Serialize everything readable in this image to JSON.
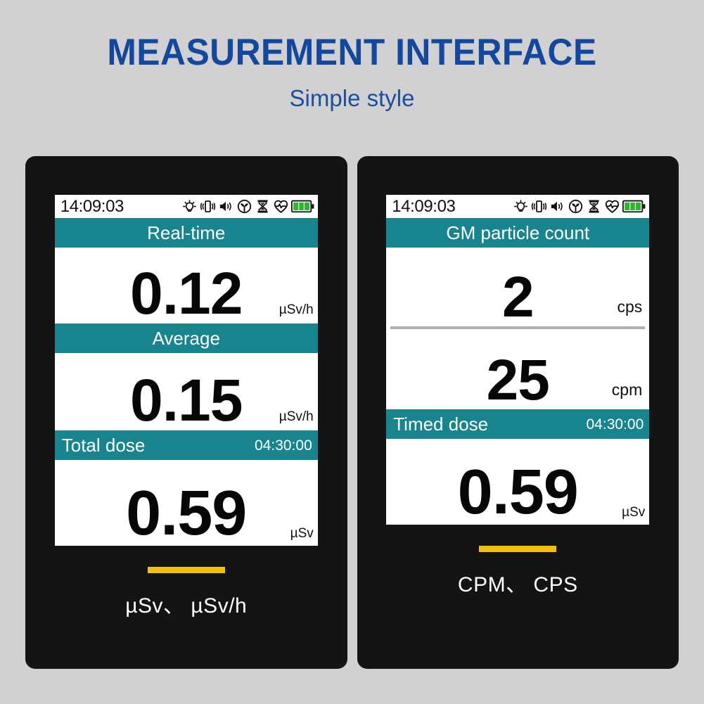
{
  "header": {
    "title": "MEASUREMENT INTERFACE",
    "subtitle": "Simple style"
  },
  "colors": {
    "page_background": "#d1d1d1",
    "title_blue": "#14489e",
    "subtitle_blue": "#1a4f9c",
    "device_body": "#141414",
    "band_teal": "#18858e",
    "accent_yellow": "#f2c00c",
    "battery_green": "#2db52d",
    "divider_grey": "#b0b0b0"
  },
  "devices": [
    {
      "name": "dose-rate-device",
      "statusbar": {
        "clock": "14:09:03",
        "icons": [
          "brightness-icon",
          "vibration-icon",
          "speaker-icon",
          "sprout-icon",
          "hourglass-icon",
          "heartbeat-icon",
          "battery-icon"
        ]
      },
      "rows": [
        {
          "label": "Real-time",
          "value": "0.12",
          "unit": "µSv/h"
        },
        {
          "label": "Average",
          "value": "0.15",
          "unit": "µSv/h"
        },
        {
          "label": "Total dose",
          "timer": "04:30:00",
          "value": "0.59",
          "unit": "µSv"
        }
      ],
      "caption": "µSv、 µSv/h"
    },
    {
      "name": "particle-count-device",
      "statusbar": {
        "clock": "14:09:03",
        "icons": [
          "brightness-icon",
          "vibration-icon",
          "speaker-icon",
          "sprout-icon",
          "hourglass-icon",
          "heartbeat-icon",
          "battery-icon"
        ]
      },
      "header_label": "GM particle count",
      "counts": [
        {
          "value": "2",
          "unit": "cps"
        },
        {
          "value": "25",
          "unit": "cpm"
        }
      ],
      "dose": {
        "label": "Timed dose",
        "timer": "04:30:00",
        "value": "0.59",
        "unit": "µSv"
      },
      "caption": "CPM、 CPS"
    }
  ]
}
